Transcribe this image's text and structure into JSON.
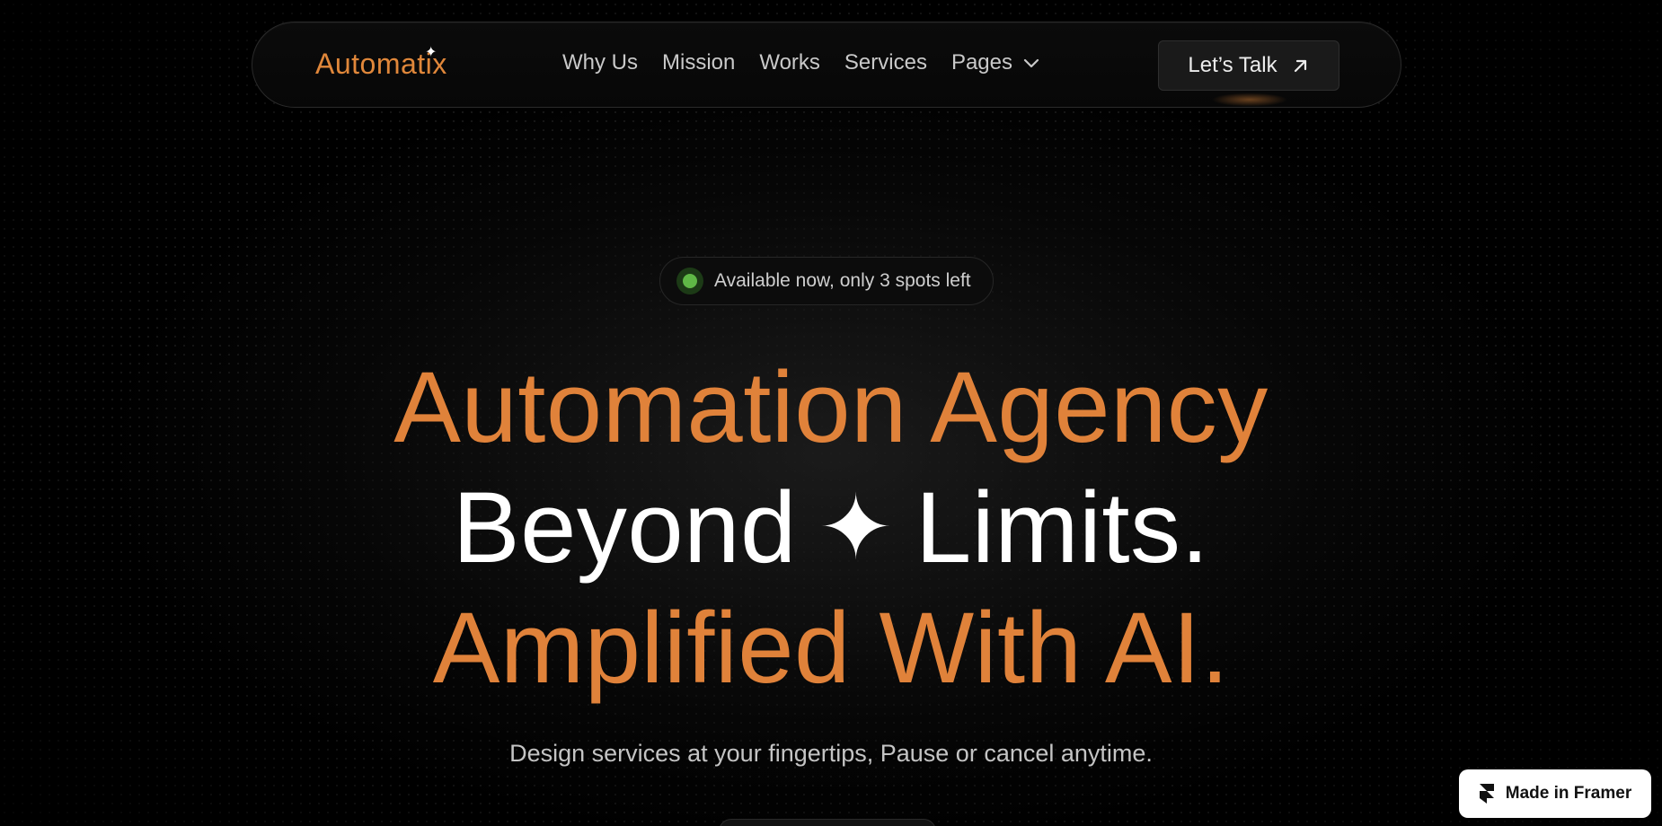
{
  "nav": {
    "logo": "Automatix",
    "links": [
      "Why Us",
      "Mission",
      "Works",
      "Services",
      "Pages"
    ],
    "cta_label": "Let’s Talk"
  },
  "badge": {
    "text": "Available now, only 3 spots left"
  },
  "hero": {
    "line1": "Automation Agency",
    "line2_left": "Beyond",
    "line2_right": "Limits.",
    "line3": "Amplified With AI.",
    "subtitle": "Design services at your fingertips, Pause or cancel anytime."
  },
  "framer_badge": {
    "label": "Made in Framer"
  },
  "colors": {
    "accent": "#e0823a",
    "background": "#000000",
    "status_green": "#5fb846"
  },
  "icons": {
    "logo_star": "sparkle-icon",
    "pages_dropdown": "chevron-down-icon",
    "cta": "arrow-up-right-icon",
    "headline_divider": "sparkle-icon",
    "framer": "framer-icon"
  }
}
